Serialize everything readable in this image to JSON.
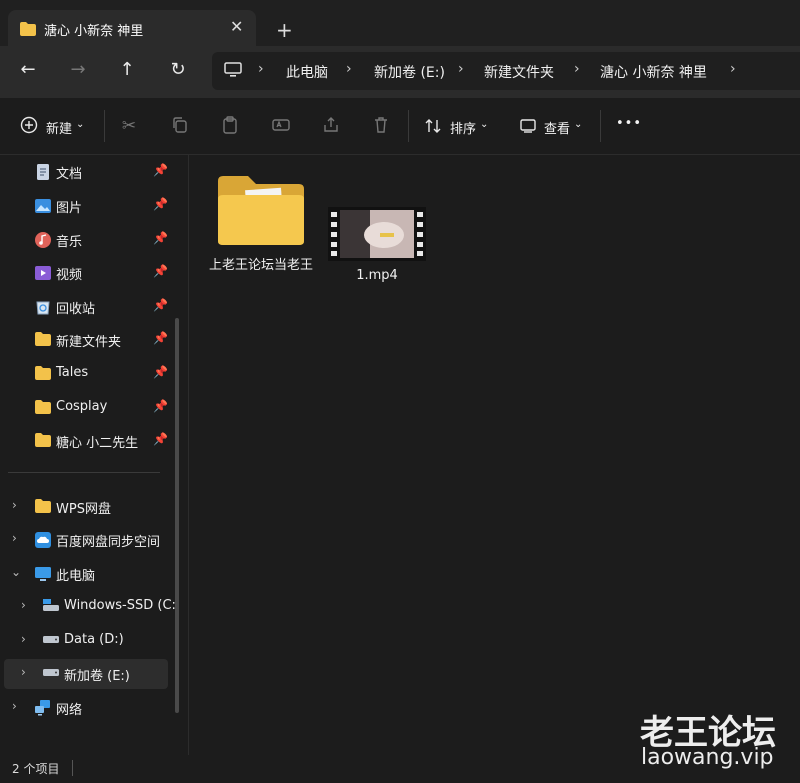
{
  "tab": {
    "title": "溏心 小新奈 神里",
    "close_label": "✕",
    "new_tab_label": "+"
  },
  "nav": {
    "back": "←",
    "forward": "→",
    "up": "↑",
    "refresh": "↻",
    "breadcrumbs": [
      "此电脑",
      "新加卷 (E:)",
      "新建文件夹",
      "溏心 小新奈 神里"
    ],
    "separator": "›"
  },
  "toolbar": {
    "new_label": "新建",
    "sort_label": "排序",
    "view_label": "查看",
    "more_label": "•••"
  },
  "sidebar": {
    "quick_access": [
      {
        "label": "文档",
        "icon": "document-icon"
      },
      {
        "label": "图片",
        "icon": "picture-icon"
      },
      {
        "label": "音乐",
        "icon": "music-icon"
      },
      {
        "label": "视频",
        "icon": "video-icon"
      },
      {
        "label": "回收站",
        "icon": "recycle-bin-icon"
      },
      {
        "label": "新建文件夹",
        "icon": "folder-icon"
      },
      {
        "label": "Tales",
        "icon": "folder-icon"
      },
      {
        "label": "Cosplay",
        "icon": "folder-icon"
      },
      {
        "label": "糖心 小二先生",
        "icon": "folder-icon"
      }
    ],
    "tree": [
      {
        "label": "WPS网盘",
        "icon": "folder-icon"
      },
      {
        "label": "百度网盘同步空间",
        "icon": "cloud-icon"
      },
      {
        "label": "此电脑",
        "icon": "computer-icon"
      },
      {
        "label": "Windows-SSD (C:",
        "icon": "drive-icon"
      },
      {
        "label": "Data (D:)",
        "icon": "drive-icon"
      },
      {
        "label": "新加卷 (E:)",
        "icon": "drive-icon"
      },
      {
        "label": "网络",
        "icon": "network-icon"
      }
    ]
  },
  "files": [
    {
      "name": "上老王论坛当老王",
      "type": "folder"
    },
    {
      "name": "1.mp4",
      "type": "video"
    }
  ],
  "status": {
    "count": "2 个项目"
  },
  "watermark": {
    "title": "老王论坛",
    "url": "laowang.vip"
  },
  "colors": {
    "folder": "#f3c24a",
    "background": "#1c1c1c",
    "selected": "#2d2d2d"
  }
}
